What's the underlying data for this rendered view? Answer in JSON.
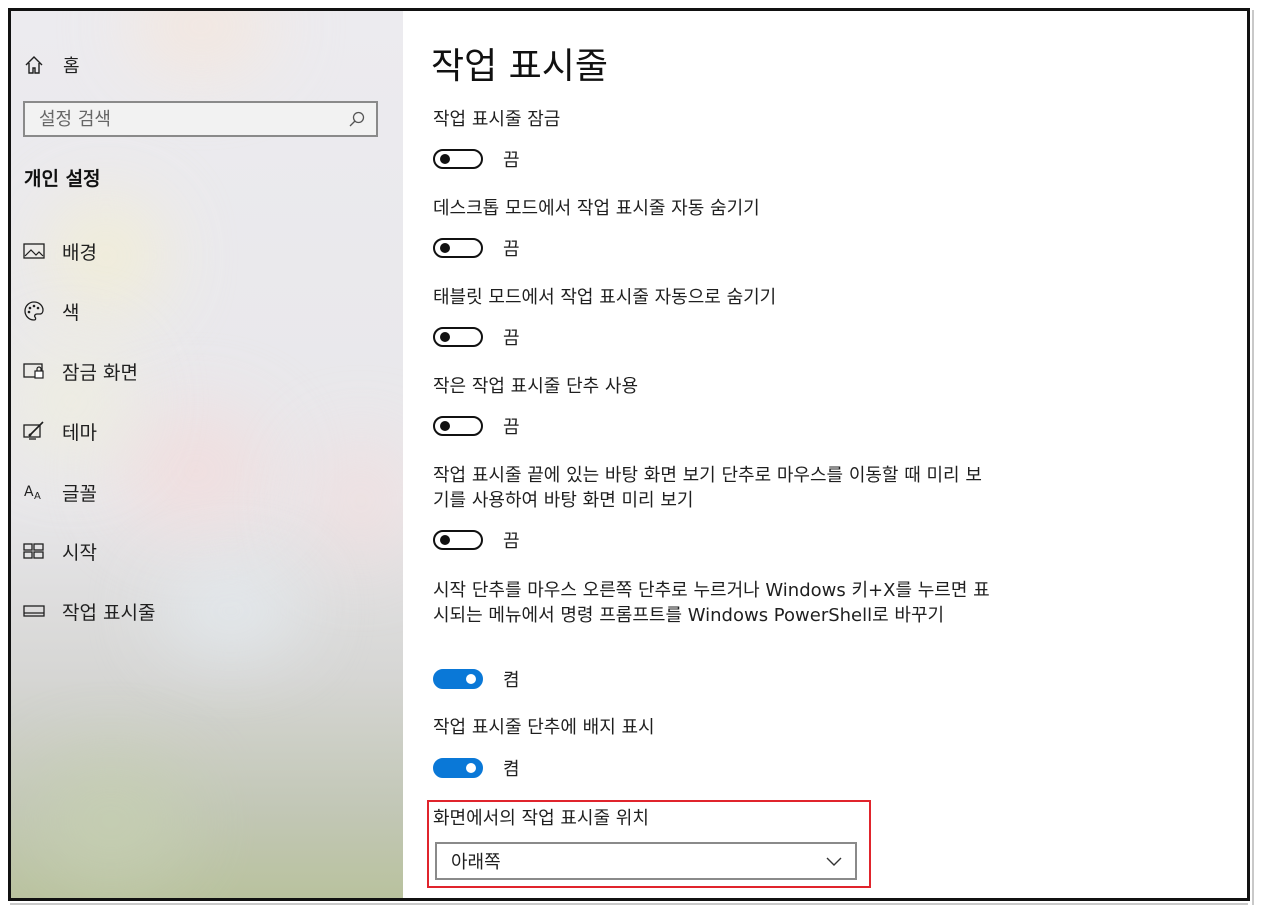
{
  "sidebar": {
    "home_label": "홈",
    "search_placeholder": "설정 검색",
    "section_title": "개인 설정",
    "items": [
      {
        "label": "배경",
        "icon": "image-icon"
      },
      {
        "label": "색",
        "icon": "palette-icon"
      },
      {
        "label": "잠금 화면",
        "icon": "lock-screen-icon"
      },
      {
        "label": "테마",
        "icon": "theme-icon"
      },
      {
        "label": "글꼴",
        "icon": "font-icon"
      },
      {
        "label": "시작",
        "icon": "start-icon"
      },
      {
        "label": "작업 표시줄",
        "icon": "taskbar-icon"
      }
    ]
  },
  "main": {
    "title": "작업 표시줄",
    "settings": [
      {
        "label": "작업 표시줄 잠금",
        "state": "끔",
        "on": false
      },
      {
        "label": "데스크톱 모드에서 작업 표시줄 자동 숨기기",
        "state": "끔",
        "on": false
      },
      {
        "label": "태블릿 모드에서 작업 표시줄 자동으로 숨기기",
        "state": "끔",
        "on": false
      },
      {
        "label": "작은 작업 표시줄 단추 사용",
        "state": "끔",
        "on": false
      },
      {
        "label": "작업 표시줄 끝에 있는 바탕 화면 보기 단추로 마우스를 이동할 때 미리 보기를 사용하여 바탕 화면 미리 보기",
        "state": "끔",
        "on": false
      },
      {
        "label": "시작 단추를 마우스 오른쪽 단추로 누르거나 Windows 키+X를 누르면 표시되는 메뉴에서 명령 프롬프트를 Windows PowerShell로 바꾸기",
        "state": "켬",
        "on": true
      },
      {
        "label": "작업 표시줄 단추에 배지 표시",
        "state": "켬",
        "on": true
      }
    ],
    "position": {
      "label": "화면에서의 작업 표시줄 위치",
      "value": "아래쪽"
    }
  },
  "colors": {
    "accent": "#0a78d7",
    "highlight_border": "#e0242c"
  }
}
